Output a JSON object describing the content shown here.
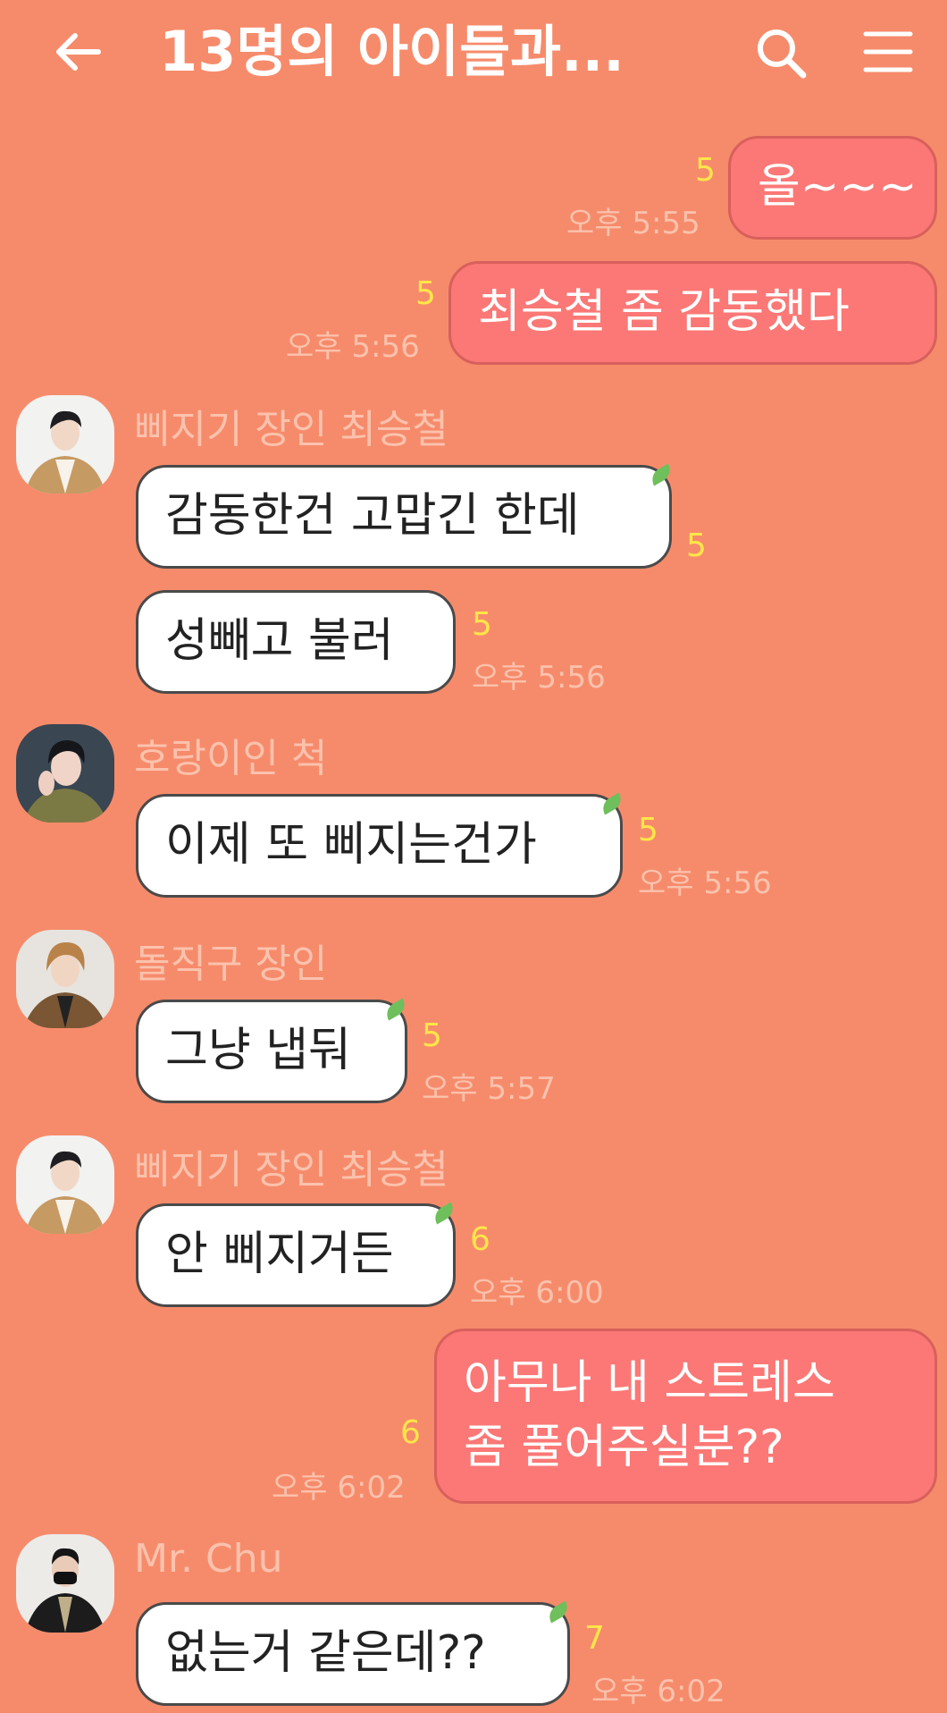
{
  "header": {
    "title": "13명의 아이들과...",
    "back_icon": "arrow-left-icon",
    "search_icon": "search-icon",
    "menu_icon": "menu-icon"
  },
  "colors": {
    "background": "#f68b6b",
    "incoming_bubble": "#ffffff",
    "outgoing_bubble": "#fb7876",
    "unread_count": "#ffe54a",
    "meta_text": "#fbc2ad"
  },
  "messages": [
    {
      "side": "out",
      "text": "올~~~",
      "unread": "5",
      "time": "오후 5:55"
    },
    {
      "side": "out",
      "text": "최승철 좀 감동했다",
      "unread": "5",
      "time": "오후 5:56"
    },
    {
      "side": "in",
      "sender": "삐지기 장인 최승철",
      "text": "감동한건 고맙긴 한데",
      "unread": "5"
    },
    {
      "side": "in",
      "text": "성빼고 불러",
      "unread": "5",
      "time": "오후 5:56"
    },
    {
      "side": "in",
      "sender": "호랑이인 척",
      "text": "이제 또 삐지는건가",
      "unread": "5",
      "time": "오후 5:56"
    },
    {
      "side": "in",
      "sender": "돌직구 장인",
      "text": "그냥 냅둬",
      "unread": "5",
      "time": "오후 5:57"
    },
    {
      "side": "in",
      "sender": "삐지기 장인 최승철",
      "text": "안 삐지거든",
      "unread": "6",
      "time": "오후 6:00"
    },
    {
      "side": "out",
      "lines": [
        "아무나 내 스트레스",
        "좀 풀어주실분??"
      ],
      "unread": "6",
      "time": "오후 6:02"
    },
    {
      "side": "in",
      "sender": "Mr. Chu",
      "text": "없는거 같은데??",
      "unread": "7",
      "time": "오후 6:02"
    }
  ]
}
